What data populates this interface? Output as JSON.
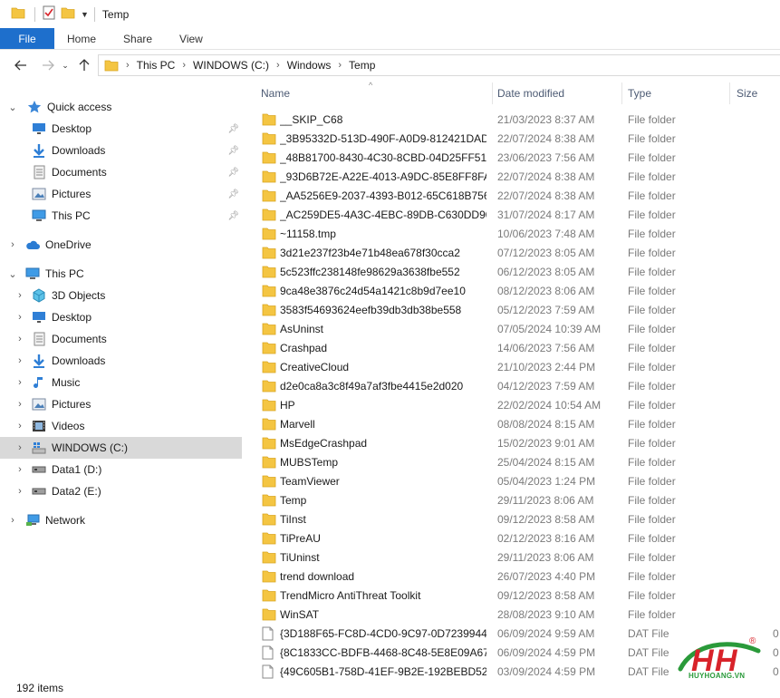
{
  "window": {
    "title": "Temp"
  },
  "ribbon": {
    "tabs": [
      "File",
      "Home",
      "Share",
      "View"
    ]
  },
  "address": {
    "crumbs": [
      "This PC",
      "WINDOWS (C:)",
      "Windows",
      "Temp"
    ]
  },
  "nav": {
    "quick_access": "Quick access",
    "qa_items": [
      "Desktop",
      "Downloads",
      "Documents",
      "Pictures",
      "This PC"
    ],
    "onedrive": "OneDrive",
    "this_pc": "This PC",
    "pc_items": [
      "3D Objects",
      "Desktop",
      "Documents",
      "Downloads",
      "Music",
      "Pictures",
      "Videos",
      "WINDOWS (C:)",
      "Data1 (D:)",
      "Data2 (E:)"
    ],
    "network": "Network"
  },
  "columns": {
    "name": "Name",
    "date": "Date modified",
    "type": "Type",
    "size": "Size"
  },
  "files": [
    {
      "name": "__SKIP_C68",
      "date": "21/03/2023 8:37 AM",
      "type": "File folder",
      "kind": "folder"
    },
    {
      "name": "_3B95332D-513D-490F-A0D9-812421DAD...",
      "date": "22/07/2024 8:38 AM",
      "type": "File folder",
      "kind": "folder"
    },
    {
      "name": "_48B81700-8430-4C30-8CBD-04D25FF513...",
      "date": "23/06/2023 7:56 AM",
      "type": "File folder",
      "kind": "folder"
    },
    {
      "name": "_93D6B72E-A22E-4013-A9DC-85E8FF8FA0...",
      "date": "22/07/2024 8:38 AM",
      "type": "File folder",
      "kind": "folder"
    },
    {
      "name": "_AA5256E9-2037-4393-B012-65C618B756...",
      "date": "22/07/2024 8:38 AM",
      "type": "File folder",
      "kind": "folder"
    },
    {
      "name": "_AC259DE5-4A3C-4EBC-89DB-C630DD90...",
      "date": "31/07/2024 8:17 AM",
      "type": "File folder",
      "kind": "folder"
    },
    {
      "name": "~11158.tmp",
      "date": "10/06/2023 7:48 AM",
      "type": "File folder",
      "kind": "folder"
    },
    {
      "name": "3d21e237f23b4e71b48ea678f30cca2",
      "date": "07/12/2023 8:05 AM",
      "type": "File folder",
      "kind": "folder"
    },
    {
      "name": "5c523ffc238148fe98629a3638fbe552",
      "date": "06/12/2023 8:05 AM",
      "type": "File folder",
      "kind": "folder"
    },
    {
      "name": "9ca48e3876c24d54a1421c8b9d7ee10",
      "date": "08/12/2023 8:06 AM",
      "type": "File folder",
      "kind": "folder"
    },
    {
      "name": "3583f54693624eefb39db3db38be558",
      "date": "05/12/2023 7:59 AM",
      "type": "File folder",
      "kind": "folder"
    },
    {
      "name": "AsUninst",
      "date": "07/05/2024 10:39 AM",
      "type": "File folder",
      "kind": "folder"
    },
    {
      "name": "Crashpad",
      "date": "14/06/2023 7:56 AM",
      "type": "File folder",
      "kind": "folder"
    },
    {
      "name": "CreativeCloud",
      "date": "21/10/2023 2:44 PM",
      "type": "File folder",
      "kind": "folder"
    },
    {
      "name": "d2e0ca8a3c8f49a7af3fbe4415e2d020",
      "date": "04/12/2023 7:59 AM",
      "type": "File folder",
      "kind": "folder"
    },
    {
      "name": "HP",
      "date": "22/02/2024 10:54 AM",
      "type": "File folder",
      "kind": "folder"
    },
    {
      "name": "Marvell",
      "date": "08/08/2024 8:15 AM",
      "type": "File folder",
      "kind": "folder"
    },
    {
      "name": "MsEdgeCrashpad",
      "date": "15/02/2023 9:01 AM",
      "type": "File folder",
      "kind": "folder"
    },
    {
      "name": "MUBSTemp",
      "date": "25/04/2024 8:15 AM",
      "type": "File folder",
      "kind": "folder"
    },
    {
      "name": "TeamViewer",
      "date": "05/04/2023 1:24 PM",
      "type": "File folder",
      "kind": "folder"
    },
    {
      "name": "Temp",
      "date": "29/11/2023 8:06 AM",
      "type": "File folder",
      "kind": "folder"
    },
    {
      "name": "TiInst",
      "date": "09/12/2023 8:58 AM",
      "type": "File folder",
      "kind": "folder"
    },
    {
      "name": "TiPreAU",
      "date": "02/12/2023 8:16 AM",
      "type": "File folder",
      "kind": "folder"
    },
    {
      "name": "TiUninst",
      "date": "29/11/2023 8:06 AM",
      "type": "File folder",
      "kind": "folder"
    },
    {
      "name": "trend download",
      "date": "26/07/2023 4:40 PM",
      "type": "File folder",
      "kind": "folder"
    },
    {
      "name": "TrendMicro AntiThreat Toolkit",
      "date": "09/12/2023 8:58 AM",
      "type": "File folder",
      "kind": "folder"
    },
    {
      "name": "WinSAT",
      "date": "28/08/2023 9:10 AM",
      "type": "File folder",
      "kind": "folder"
    },
    {
      "name": "{3D188F65-FC8D-4CD0-9C97-0D7239944...",
      "date": "06/09/2024 9:59 AM",
      "type": "DAT File",
      "size": "0",
      "kind": "file"
    },
    {
      "name": "{8C1833CC-BDFB-4468-8C48-5E8E09A67...",
      "date": "06/09/2024 4:59 PM",
      "type": "DAT File",
      "size": "0",
      "kind": "file"
    },
    {
      "name": "{49C605B1-758D-41EF-9B2E-192BEBD524...",
      "date": "03/09/2024 4:59 PM",
      "type": "DAT File",
      "size": "0",
      "kind": "file"
    }
  ],
  "status": {
    "items": "192 items"
  },
  "logo": {
    "letters": "HH",
    "brand": "HUYHOANG.VN",
    "mark": "®"
  },
  "colors": {
    "accent": "#1e6fcc",
    "folder": "#f4c542",
    "selected": "#d9d9d9",
    "logo_red": "#d8232a",
    "logo_green": "#2a9a3a"
  }
}
